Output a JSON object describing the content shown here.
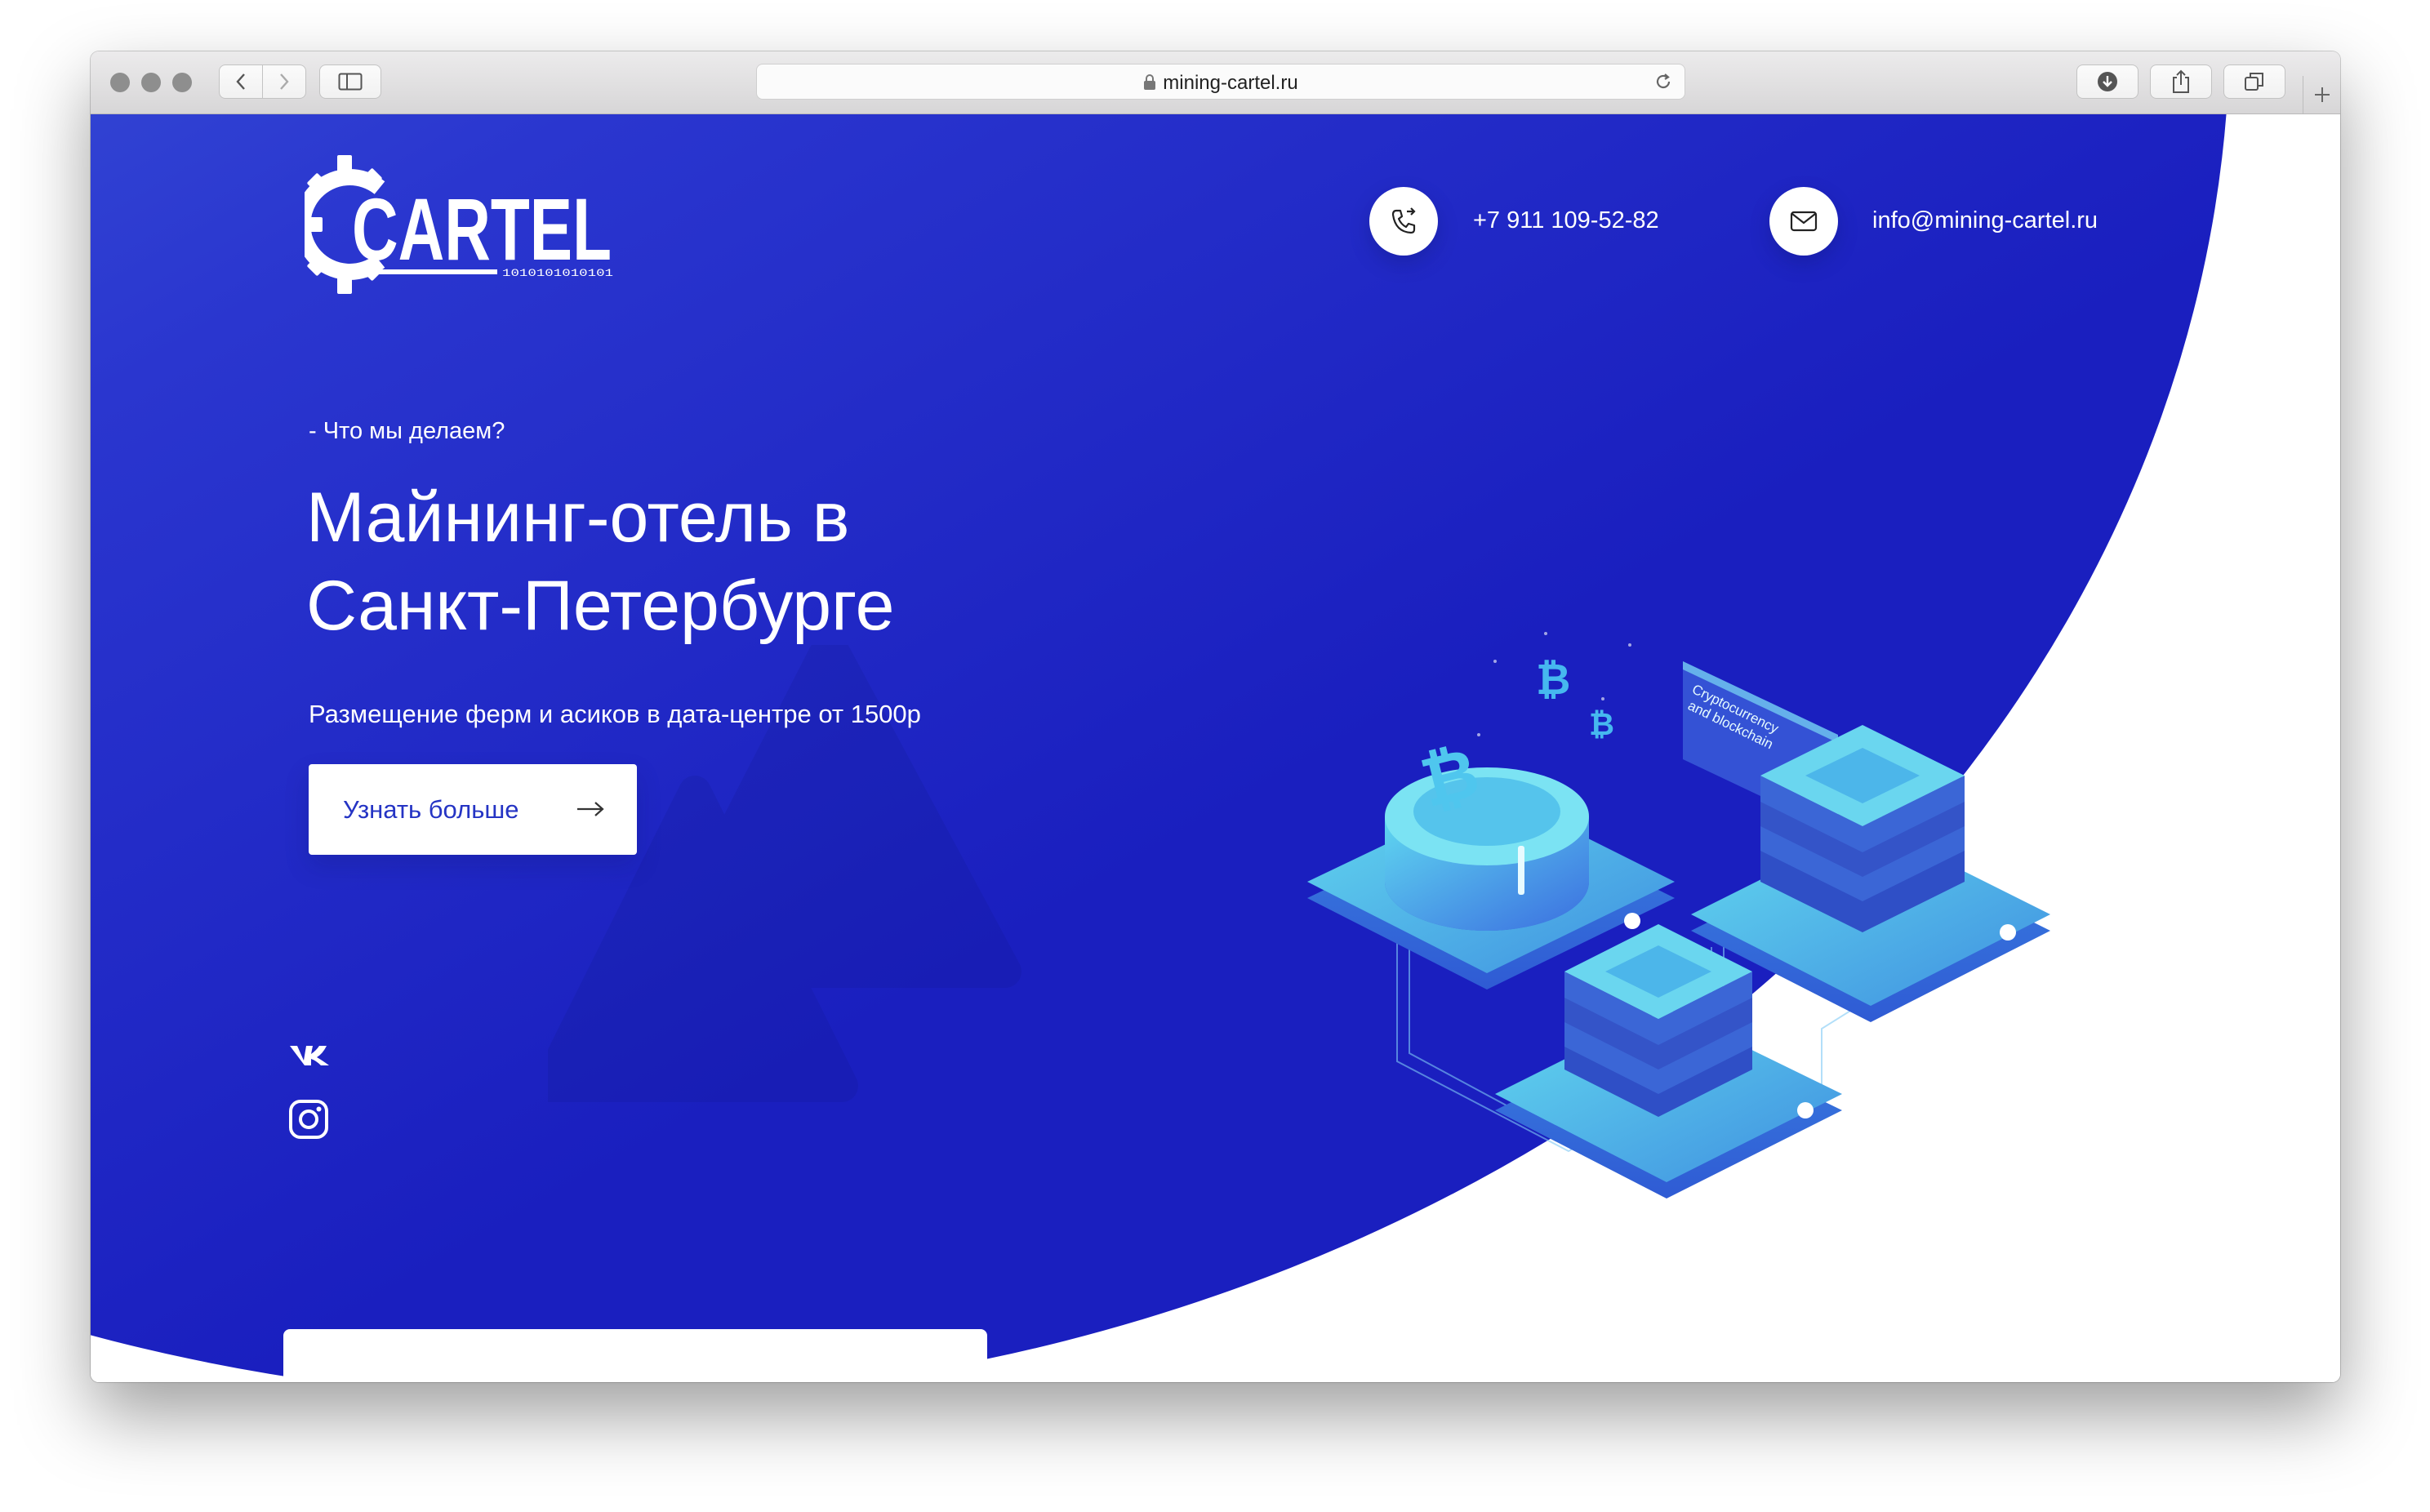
{
  "browser": {
    "url": "mining-cartel.ru"
  },
  "header": {
    "logo_text": "CARTEL",
    "logo_binary": "1010101010101",
    "phone": "+7 911 109-52-82",
    "email": "info@mining-cartel.ru"
  },
  "hero": {
    "eyebrow": "- Что мы делаем?",
    "title_line1": "Майнинг-отель в",
    "title_line2": "Санкт-Петербурге",
    "subtitle": "Размещение ферм и асиков в дата-центре от 1500р",
    "cta_label": "Узнать больше"
  },
  "illustration": {
    "sign_text_line1": "Cryptocurrency",
    "sign_text_line2": "and blockchain"
  },
  "social": [
    "vk-icon",
    "instagram-icon"
  ],
  "colors": {
    "hero_blue_light": "#4160dc",
    "hero_blue_dark": "#1a1fbf",
    "accent_teal": "#4fd1e8",
    "cta_text": "#2534c4"
  }
}
